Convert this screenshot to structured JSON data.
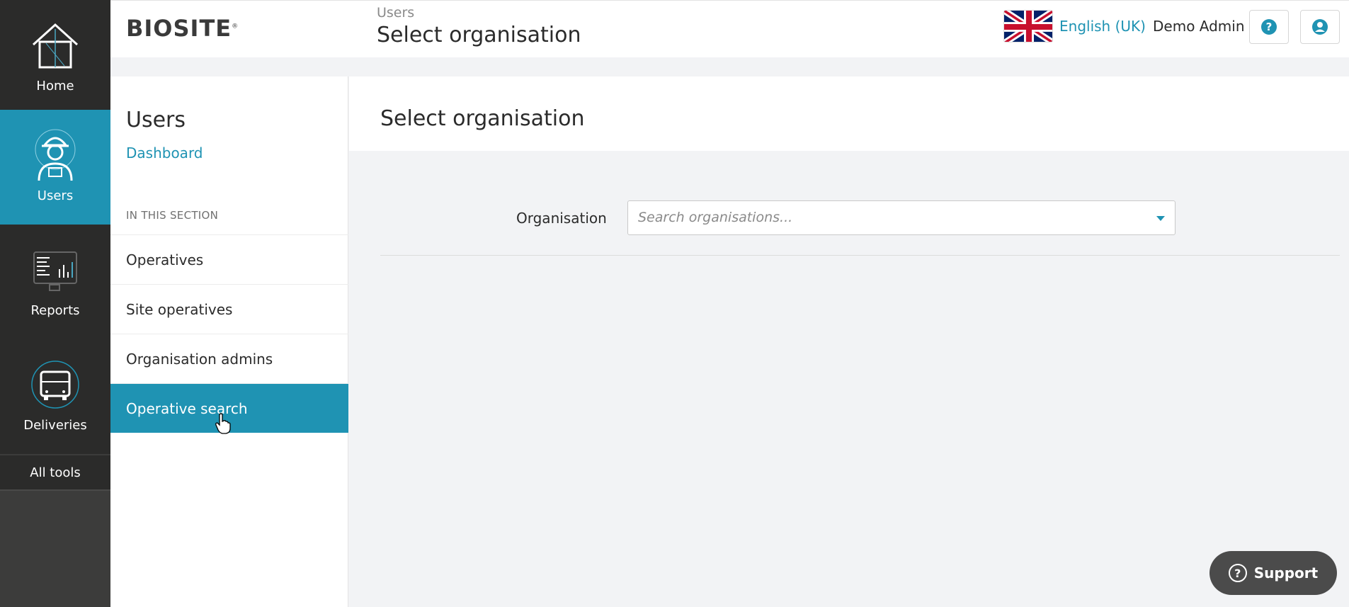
{
  "rail": {
    "items": [
      {
        "label": "Home",
        "icon": "house-icon"
      },
      {
        "label": "Users",
        "icon": "worker-icon"
      },
      {
        "label": "Reports",
        "icon": "report-icon"
      },
      {
        "label": "Deliveries",
        "icon": "truck-icon"
      }
    ],
    "all_tools": "All tools"
  },
  "header": {
    "logo": "BIOSITE",
    "logo_mark": "®",
    "breadcrumb": "Users",
    "title": "Select organisation",
    "language": "English (UK)",
    "user": "Demo Admin"
  },
  "nav": {
    "title": "Users",
    "dashboard": "Dashboard",
    "section": "IN THIS SECTION",
    "items": [
      {
        "label": "Operatives"
      },
      {
        "label": "Site operatives"
      },
      {
        "label": "Organisation admins"
      },
      {
        "label": "Operative search"
      }
    ]
  },
  "main": {
    "title": "Select organisation",
    "org_label": "Organisation",
    "org_placeholder": "Search organisations..."
  },
  "support": {
    "label": "Support"
  },
  "colors": {
    "accent": "#1f93b3",
    "rail": "#2b2b2a"
  }
}
